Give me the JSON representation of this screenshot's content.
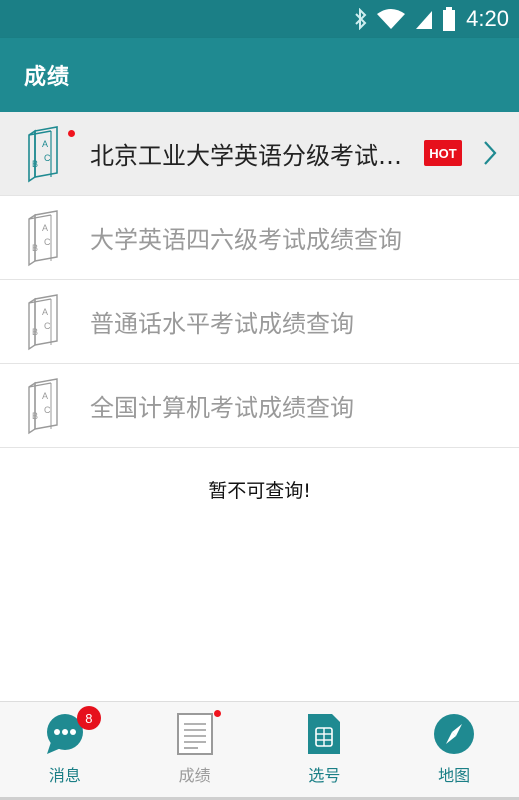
{
  "status_bar": {
    "time": "4:20",
    "icons": [
      "bluetooth-icon",
      "wifi-icon",
      "signal-icon",
      "battery-icon"
    ]
  },
  "app_bar": {
    "title": "成绩"
  },
  "list": {
    "items": [
      {
        "label": "北京工业大学英语分级考试成绩查询",
        "icon": "book-icon",
        "active": true,
        "badge": "HOT"
      },
      {
        "label": "大学英语四六级考试成绩查询",
        "icon": "book-icon",
        "active": false
      },
      {
        "label": "普通话水平考试成绩查询",
        "icon": "book-icon",
        "active": false
      },
      {
        "label": "全国计算机考试成绩查询",
        "icon": "book-icon",
        "active": false
      }
    ]
  },
  "notice": "暂不可查询!",
  "bottom_nav": {
    "items": [
      {
        "label": "消息",
        "icon": "chat-icon",
        "badge": "8"
      },
      {
        "label": "成绩",
        "icon": "document-icon"
      },
      {
        "label": "选号",
        "icon": "sim-card-icon"
      },
      {
        "label": "地图",
        "icon": "compass-icon"
      }
    ]
  },
  "colors": {
    "primary": "#1f8a91",
    "status_bar": "#1b7f86",
    "badge_red": "#e6101c",
    "inactive_text": "#9a9a9a"
  }
}
